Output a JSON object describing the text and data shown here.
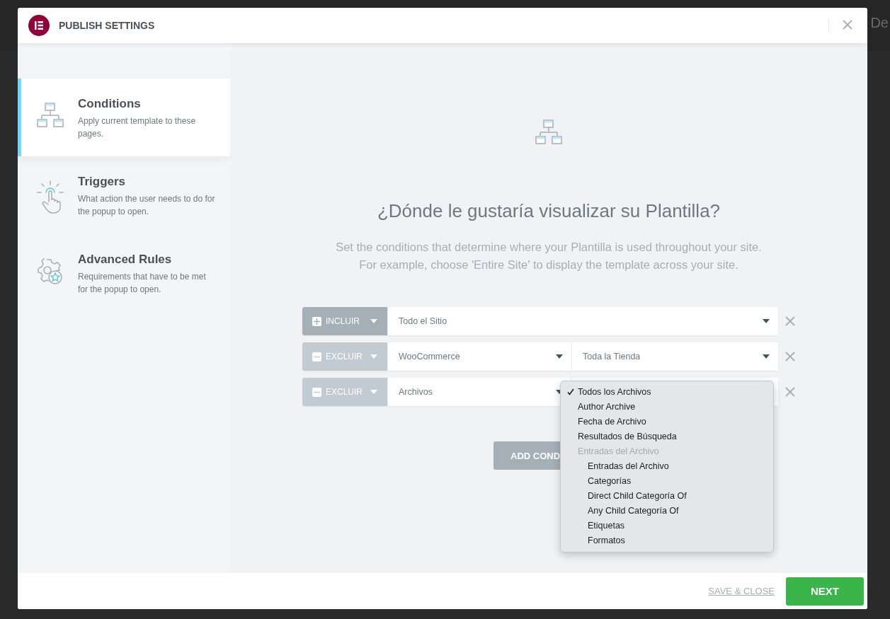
{
  "background": {
    "top_text": "De"
  },
  "window": {
    "title": "PUBLISH SETTINGS"
  },
  "sidebar": {
    "items": [
      {
        "title": "Conditions",
        "description": "Apply current template to these pages.",
        "selected": true
      },
      {
        "title": "Triggers",
        "description": "What action the user needs to do for the popup to open.",
        "selected": false
      },
      {
        "title": "Advanced Rules",
        "description": "Requirements that have to be met for the popup to open.",
        "selected": false
      }
    ]
  },
  "main": {
    "heading": "¿Dónde le gustaría visualizar su Plantilla?",
    "subtitle": [
      "Set the conditions that determine where your Plantilla is used throughout your site.",
      "For example, choose 'Entire Site' to display the template across your site."
    ],
    "conditions": [
      {
        "kind": "include",
        "label": "INCLUIR",
        "fields": [
          "Todo el Sitio"
        ]
      },
      {
        "kind": "exclude",
        "label": "EXCLUIR",
        "fields": [
          "WooCommerce",
          "Toda la Tienda"
        ]
      },
      {
        "kind": "exclude",
        "label": "EXCLUIR",
        "fields": [
          "Archivos"
        ],
        "dropdown": [
          {
            "kind": "option",
            "label": "Todos los Archivos",
            "selected": true
          },
          {
            "kind": "option",
            "label": "Author Archive",
            "selected": false
          },
          {
            "kind": "option",
            "label": "Fecha de Archivo",
            "selected": false
          },
          {
            "kind": "option",
            "label": "Resultados de Búsqueda",
            "selected": false
          },
          {
            "kind": "group",
            "label": "Entradas del Archivo",
            "children": [
              {
                "label": "Entradas del Archivo",
                "selected": false
              },
              {
                "label": "Categorías",
                "selected": false
              },
              {
                "label": "Direct Child Categoría Of",
                "selected": false
              },
              {
                "label": "Any Child Categoría Of",
                "selected": false
              },
              {
                "label": "Etiquetas",
                "selected": false
              },
              {
                "label": "Formatos",
                "selected": false
              }
            ]
          }
        ]
      }
    ],
    "add_button": "ADD COND"
  },
  "footer": {
    "save_link": "SAVE & CLOSE",
    "next_button": "NEXT"
  }
}
